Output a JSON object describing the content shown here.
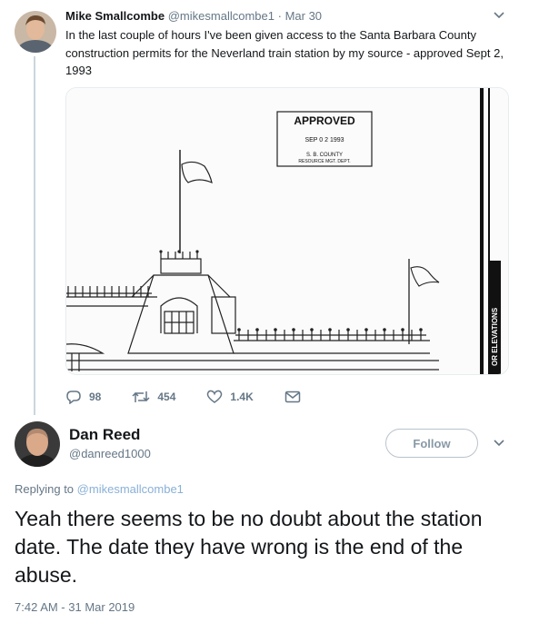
{
  "parent_tweet": {
    "author_name": "Mike Smallcombe",
    "author_handle": "@mikesmallcombe1",
    "separator": "·",
    "date": "Mar 30",
    "text": "In the last couple of hours I've been given access to the Santa Barbara County construction permits for the Neverland train station by my source - approved Sept 2, 1993",
    "media": {
      "stamp_title": "APPROVED",
      "stamp_date": "SEP 0 2 1993",
      "stamp_county": "S. B. COUNTY",
      "stamp_dept": "RESOURCE MGT. DEPT.",
      "side_label": "OR ELEVATIONS"
    },
    "actions": {
      "replies": "98",
      "retweets": "454",
      "likes": "1.4K"
    }
  },
  "reply_tweet": {
    "author_name": "Dan Reed",
    "author_handle": "@danreed1000",
    "follow_label": "Follow",
    "replying_to_label": "Replying to",
    "replying_to_handle": "@mikesmallcombe1",
    "text": "Yeah there seems to be no doubt about the station date. The date they have wrong is the end of the abuse.",
    "timestamp": "7:42 AM - 31 Mar 2019"
  },
  "colors": {
    "text_primary": "#14171a",
    "text_secondary": "#657786",
    "border": "#e6ecf0",
    "thread_line": "#ccd6dd",
    "mention": "#8ab0d6"
  },
  "icons": {
    "reply": "reply-icon",
    "retweet": "retweet-icon",
    "like": "heart-icon",
    "message": "envelope-icon",
    "menu": "chevron-down-icon"
  }
}
